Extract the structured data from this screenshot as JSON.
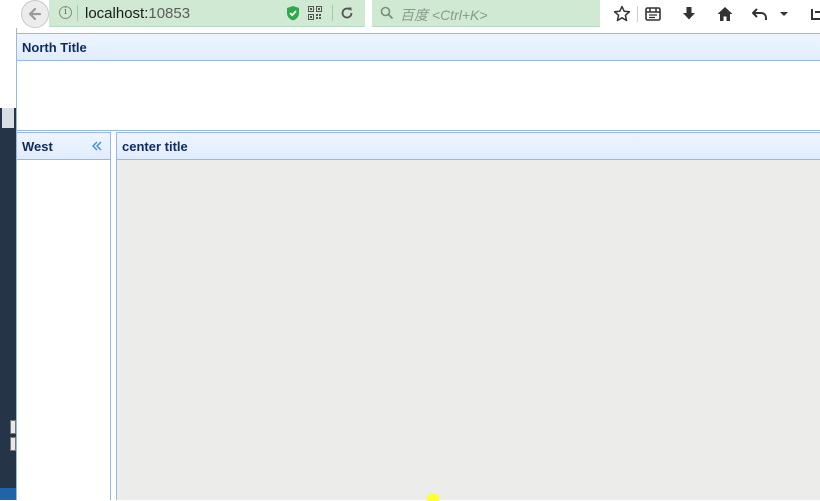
{
  "browser": {
    "url_host": "localhost:",
    "url_port": "10853",
    "search_placeholder": "百度 <Ctrl+K>",
    "accent": "#cfe9d3",
    "icons": [
      "back-icon",
      "info-icon",
      "shield-icon",
      "qr-code-icon",
      "reload-icon",
      "search-icon",
      "star-icon",
      "reading-list-icon",
      "download-icon",
      "home-icon",
      "undo-icon",
      "menu-dropdown-icon"
    ]
  },
  "layout": {
    "north": {
      "title": "North Title"
    },
    "west": {
      "title": "West",
      "collapse_icon": "double-chevron-left-icon"
    },
    "center": {
      "title": "center title"
    },
    "colors": {
      "border": "#95b8e7",
      "header": "#e0ecff",
      "title_text": "#0e2d5f",
      "center_body": "#ececea"
    }
  }
}
